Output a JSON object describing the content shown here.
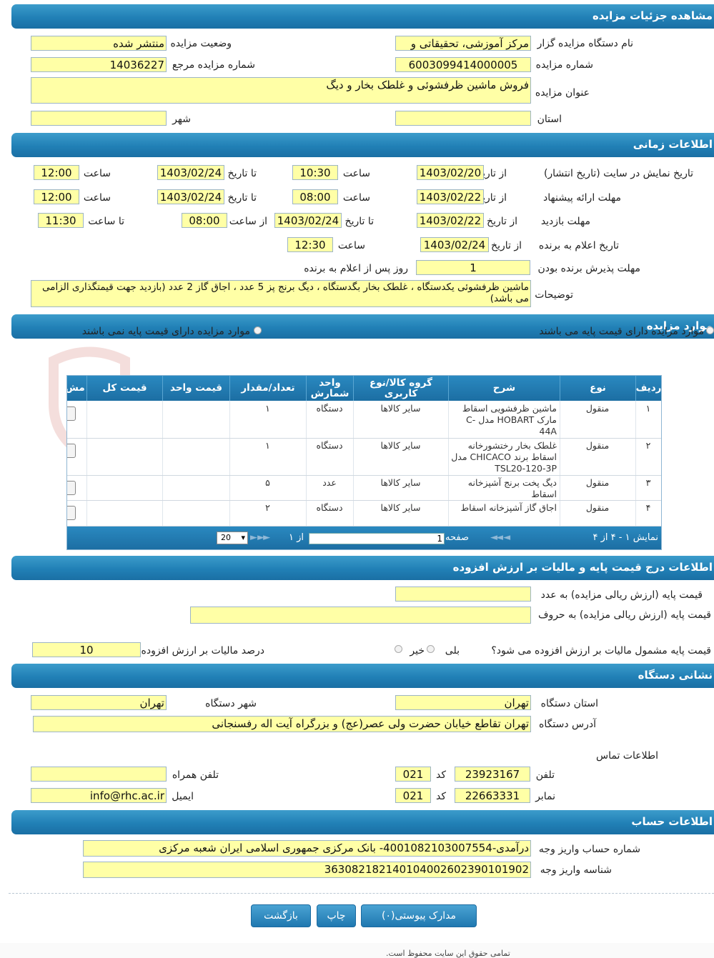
{
  "sections": {
    "details": "مشاهده جزئیات مزایده",
    "timing": "اطلاعات زمانی",
    "items": "موارد مزایده",
    "base_price": "اطلاعات درج قیمت پایه و مالیات بر ارزش افزوده",
    "address": "نشانی دستگاه",
    "account": "اطلاعات حساب"
  },
  "details": {
    "org_label": "نام دستگاه مزایده گزار",
    "org_value": "مرکز آموزشی، تحقیقاتی و",
    "status_label": "وضعیت مزایده",
    "status_value": "منتشر شده",
    "number_label": "شماره مزایده",
    "number_value": "6003099414000005",
    "ref_label": "شماره مزایده مرجع",
    "ref_value": "14036227",
    "title_label": "عنوان مزایده",
    "title_value": "فروش ماشین ظرفشوئی و غلطک بخار و دیگ",
    "province_label": "استان",
    "province_value": "",
    "city_label": "شهر",
    "city_value": ""
  },
  "timing": {
    "display_label": "تاریخ نمایش در سایت (تاریخ انتشار)",
    "offer_label": "مهلت ارائه پیشنهاد",
    "visit_label": "مهلت بازدید",
    "announce_label": "تاریخ اعلام به برنده",
    "accept_label": "مهلت پذیرش برنده بودن",
    "from_date": "از تاریخ",
    "to_date": "تا تاریخ",
    "time": "ساعت",
    "from_time": "از ساعت",
    "to_time": "تا ساعت",
    "display_from": "1403/02/20",
    "display_from_time": "10:30",
    "display_to": "1403/02/24",
    "display_to_time": "12:00",
    "offer_from": "1403/02/22",
    "offer_from_time": "08:00",
    "offer_to": "1403/02/24",
    "offer_to_time": "12:00",
    "visit_from": "1403/02/22",
    "visit_to": "1403/02/24",
    "visit_from_time": "08:00",
    "visit_to_time": "11:30",
    "announce_date": "1403/02/24",
    "announce_time": "12:30",
    "accept_value": "1",
    "accept_suffix": "روز پس از اعلام به برنده",
    "desc_label": "توضیحات",
    "desc_value": "ماشین ظرفشوئی یکدستگاه ، غلطک بخار بگدستگاه ، دیگ برنج پز 5 عدد ، اجاق گاز 2 عدد (بازدید جهت قیمتگذاری الزامی می باشد)"
  },
  "items": {
    "radio_with": "موارد مزایده دارای قیمت پایه می باشند",
    "radio_without": "موارد مزایده دارای قیمت پایه نمی باشند",
    "headers": [
      "ردیف",
      "نوع",
      "شرح",
      "گروه کالا/نوع کاربری",
      "واحد شمارش",
      "تعداد/مقدار",
      "قیمت واحد",
      "قیمت کل",
      "مش"
    ],
    "rows": [
      {
        "n": "۱",
        "type": "منقول",
        "desc": "ماشین ظرفشویی اسقاط مارک HOBART مدل C-44A",
        "group": "سایر کالاها",
        "unit": "دستگاه",
        "qty": "۱"
      },
      {
        "n": "۲",
        "type": "منقول",
        "desc": "غلطک بخار رختشورخانه اسقاط برند CHICACO مدل TSL20-120-3P",
        "group": "سایر کالاها",
        "unit": "دستگاه",
        "qty": "۱"
      },
      {
        "n": "۳",
        "type": "منقول",
        "desc": "دیگ پخت برنج آشپزخانه اسقاط",
        "group": "سایر کالاها",
        "unit": "عدد",
        "qty": "۵"
      },
      {
        "n": "۴",
        "type": "منقول",
        "desc": "اجاق گاز آشپزخانه اسقاط",
        "group": "سایر کالاها",
        "unit": "دستگاه",
        "qty": "۲"
      }
    ],
    "footer_showing": "نمایش ۱ - ۴ از ۴",
    "page_label": "صفحه",
    "page_value": "1",
    "of_label": "از ۱",
    "page_size": "20"
  },
  "base_price": {
    "num_label": "قیمت پایه (ارزش ریالی مزایده) به عدد",
    "num_value": "",
    "words_label": "قیمت پایه (ارزش ریالی مزایده) به حروف",
    "words_value": "",
    "vat_question": "قیمت پایه مشمول مالیات بر ارزش افزوده می شود؟",
    "yes": "بلی",
    "no": "خیر",
    "vat_percent_label": "درصد مالیات بر ارزش افزوده",
    "vat_percent_value": "10"
  },
  "address": {
    "province_label": "استان دستگاه",
    "province_value": "تهران",
    "city_label": "شهر دستگاه",
    "city_value": "تهران",
    "addr_label": "آدرس دستگاه",
    "addr_value": "تهران تقاطع خیابان حضرت ولی عصر(عج) و بزرگراه آیت اله رفسنجانی",
    "contact_label": "اطلاعات تماس",
    "phone_label": "تلفن",
    "phone_value": "23923167",
    "code_label": "کد",
    "phone_code": "021",
    "mobile_label": "تلفن همراه",
    "mobile_value": "",
    "fax_label": "نمابر",
    "fax_value": "22663331",
    "fax_code": "021",
    "email_label": "ایمیل",
    "email_value": "info@rhc.ac.ir"
  },
  "account": {
    "acct_label": "شماره حساب واریز وجه",
    "acct_value": "درآمدی-4001082103007554- بانک مرکزی جمهوری اسلامی ایران شعبه مرکزی",
    "id_label": "شناسه واریز وجه",
    "id_value": "363082182140104002602390101902"
  },
  "buttons": {
    "attachments": "مدارک پیوستی(۰)",
    "print": "چاپ",
    "back": "بازگشت"
  },
  "footer": "تمامی حقوق این سایت محفوظ است.",
  "watermark": "AriaTender.net",
  "colors": {
    "header": "#2180b6",
    "field": "#ffffa6"
  }
}
